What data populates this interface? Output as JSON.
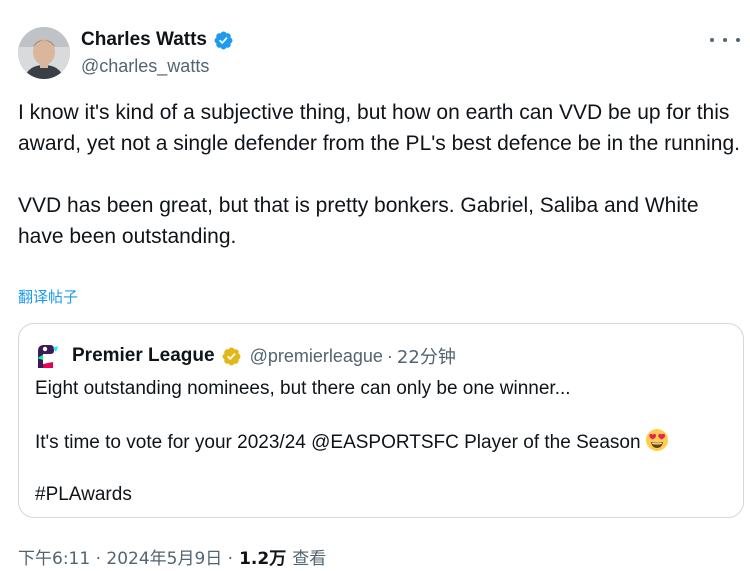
{
  "tweet": {
    "author": {
      "name": "Charles Watts",
      "handle": "@charles_watts"
    },
    "text_paragraphs": [
      "I know it's kind of a subjective thing, but how on earth can VVD be up for this award, yet not a single defender from the PL's best defence be in the running.",
      "VVD has been great, but that is pretty bonkers. Gabriel, Saliba and White have been outstanding."
    ],
    "translate_label": "翻译帖子",
    "quote": {
      "name": "Premier League",
      "handle": "@premierleague",
      "separator": "·",
      "time": "22分钟",
      "paragraphs": [
        "Eight outstanding nominees, but there can only be one winner...",
        "It's time to vote for your 2023/24 @EASPORTSFC Player of the Season",
        "#PLAwards"
      ],
      "emoji": "heart-eyes-emoji"
    },
    "meta": {
      "timestamp": "下午6:11 · 2024年5月9日 ·",
      "views_count": "1.2万",
      "views_label": "查看"
    }
  },
  "colors": {
    "verified_blue": "#1d9bf0",
    "verified_gold": "#e2b719",
    "secondary_text": "#536471",
    "border": "#cfd9de"
  }
}
